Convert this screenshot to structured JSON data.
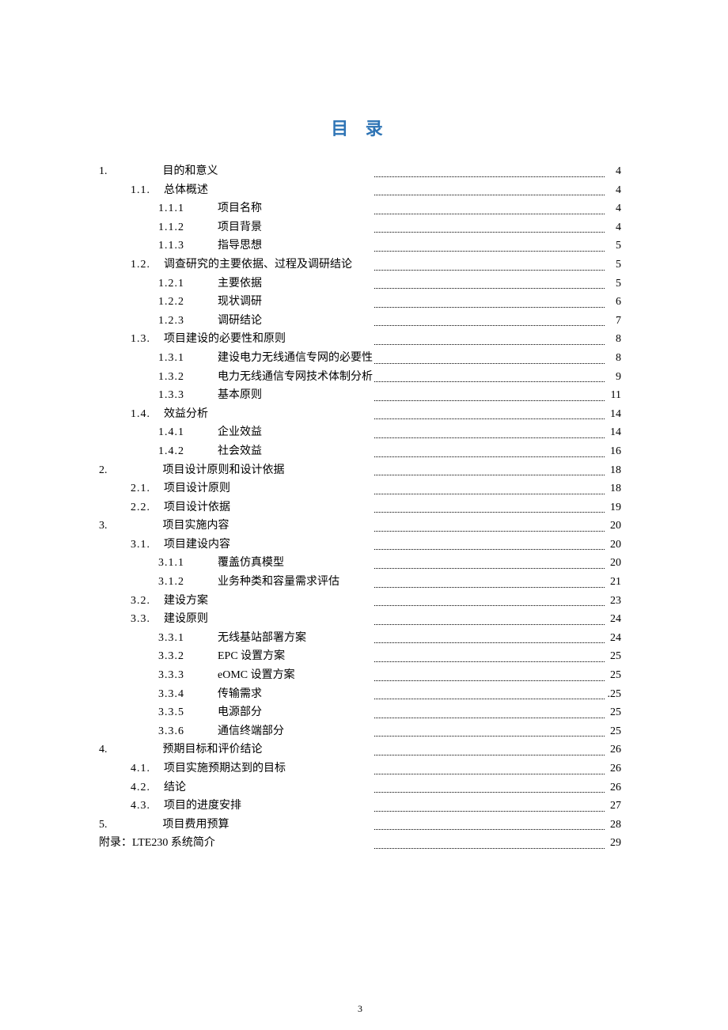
{
  "title": "目 录",
  "page_number": "3",
  "entries": [
    {
      "level": 1,
      "num": "1.",
      "text": "目的和意义",
      "page": "4"
    },
    {
      "level": 2,
      "num": "1.1.",
      "text": "总体概述",
      "page": "4"
    },
    {
      "level": 3,
      "num": "1.1.1",
      "text": "项目名称",
      "page": "4"
    },
    {
      "level": 3,
      "num": "1.1.2",
      "text": "项目背景",
      "page": "4"
    },
    {
      "level": 3,
      "num": "1.1.3",
      "text": "指导思想",
      "page": "5"
    },
    {
      "level": 2,
      "num": "1.2.",
      "text": "调查研究的主要依据、过程及调研结论",
      "page": "5"
    },
    {
      "level": 3,
      "num": "1.2.1",
      "text": "主要依据",
      "page": "5"
    },
    {
      "level": 3,
      "num": "1.2.2",
      "text": "现状调研",
      "page": "6"
    },
    {
      "level": 3,
      "num": "1.2.3",
      "text": "调研结论",
      "page": "7"
    },
    {
      "level": 2,
      "num": "1.3.",
      "text": "项目建设的必要性和原则",
      "page": "8"
    },
    {
      "level": 3,
      "num": "1.3.1",
      "text": "建设电力无线通信专网的必要性",
      "page": "8"
    },
    {
      "level": 3,
      "num": "1.3.2",
      "text": "电力无线通信专网技术体制分析",
      "page": "9"
    },
    {
      "level": 3,
      "num": "1.3.3",
      "text": "基本原则",
      "page": "11"
    },
    {
      "level": 2,
      "num": "1.4.",
      "text": "效益分析",
      "page": "14"
    },
    {
      "level": 3,
      "num": "1.4.1",
      "text": "企业效益",
      "page": "14"
    },
    {
      "level": 3,
      "num": "1.4.2",
      "text": "社会效益",
      "page": "16"
    },
    {
      "level": 1,
      "num": "2.",
      "text": "项目设计原则和设计依据",
      "page": "18"
    },
    {
      "level": 2,
      "num": "2.1.",
      "text": "项目设计原则",
      "page": "18"
    },
    {
      "level": 2,
      "num": "2.2.",
      "text": "项目设计依据",
      "page": "19"
    },
    {
      "level": 1,
      "num": "3.",
      "text": "项目实施内容",
      "page": "20"
    },
    {
      "level": 2,
      "num": "3.1.",
      "text": "项目建设内容",
      "page": "20"
    },
    {
      "level": 3,
      "num": "3.1.1",
      "text": "覆盖仿真模型",
      "page": "20"
    },
    {
      "level": 3,
      "num": "3.1.2",
      "text": "业务种类和容量需求评估",
      "page": "21"
    },
    {
      "level": 2,
      "num": "3.2.",
      "text": "建设方案",
      "page": "23"
    },
    {
      "level": 2,
      "num": "3.3.",
      "text": "建设原则",
      "page": "24"
    },
    {
      "level": 3,
      "num": "3.3.1",
      "text": "无线基站部署方案",
      "page": "24"
    },
    {
      "level": 3,
      "num": "3.3.2",
      "text": "EPC 设置方案",
      "page": "25"
    },
    {
      "level": 3,
      "num": "3.3.3",
      "text": "eOMC 设置方案",
      "page": "25"
    },
    {
      "level": 3,
      "num": "3.3.4",
      "text": "传输需求",
      "page": ".25"
    },
    {
      "level": 3,
      "num": "3.3.5",
      "text": "电源部分",
      "page": "25"
    },
    {
      "level": 3,
      "num": "3.3.6",
      "text": "通信终端部分",
      "page": "25"
    },
    {
      "level": 1,
      "num": "4.",
      "text": "预期目标和评价结论",
      "page": "26"
    },
    {
      "level": 2,
      "num": "4.1.",
      "text": "项目实施预期达到的目标",
      "page": "26"
    },
    {
      "level": 2,
      "num": "4.2.",
      "text": "结论",
      "page": "26"
    },
    {
      "level": 2,
      "num": "4.3.",
      "text": "项目的进度安排",
      "page": "27"
    },
    {
      "level": 1,
      "num": "5.",
      "text": "项目费用预算",
      "page": "28"
    },
    {
      "level": 0,
      "num": "",
      "text": "附录：LTE230 系统简介",
      "page": "29"
    }
  ]
}
